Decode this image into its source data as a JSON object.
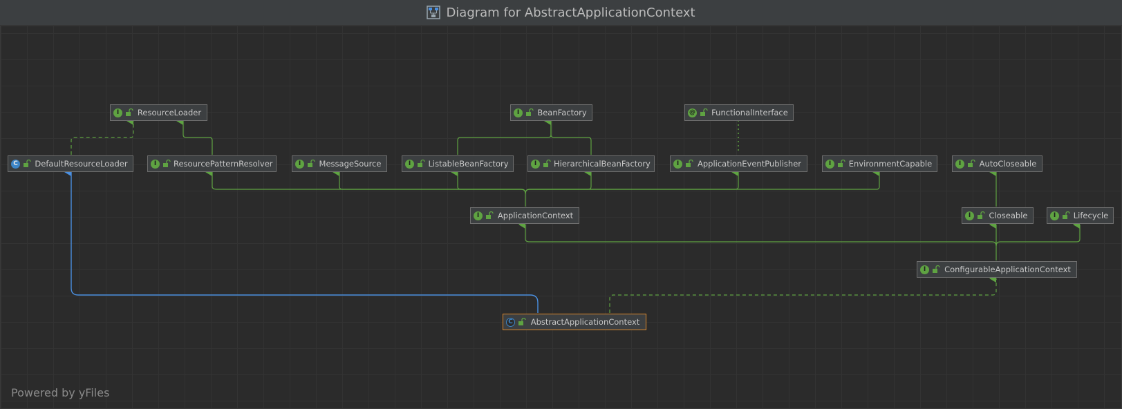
{
  "window": {
    "title": "Diagram for AbstractApplicationContext"
  },
  "footer": {
    "text": "Powered by yFiles"
  },
  "colors": {
    "inheritance": "#5fa342",
    "class_extends": "#4a8fe0",
    "selected_border": "#e08a2c"
  },
  "nodes": {
    "resource_loader": {
      "label": "ResourceLoader",
      "kind": "interface",
      "kind_glyph": "I"
    },
    "bean_factory": {
      "label": "BeanFactory",
      "kind": "interface",
      "kind_glyph": "I"
    },
    "functional_interface": {
      "label": "FunctionalInterface",
      "kind": "annotation",
      "kind_glyph": "@"
    },
    "default_resource_loader": {
      "label": "DefaultResourceLoader",
      "kind": "class",
      "kind_glyph": "C"
    },
    "resource_pattern_resolver": {
      "label": "ResourcePatternResolver",
      "kind": "interface",
      "kind_glyph": "I"
    },
    "message_source": {
      "label": "MessageSource",
      "kind": "interface",
      "kind_glyph": "I"
    },
    "listable_bean_factory": {
      "label": "ListableBeanFactory",
      "kind": "interface",
      "kind_glyph": "I"
    },
    "hierarchical_bean_factory": {
      "label": "HierarchicalBeanFactory",
      "kind": "interface",
      "kind_glyph": "I"
    },
    "application_event_publisher": {
      "label": "ApplicationEventPublisher",
      "kind": "interface",
      "kind_glyph": "I"
    },
    "environment_capable": {
      "label": "EnvironmentCapable",
      "kind": "interface",
      "kind_glyph": "I"
    },
    "auto_closeable": {
      "label": "AutoCloseable",
      "kind": "interface",
      "kind_glyph": "I"
    },
    "application_context": {
      "label": "ApplicationContext",
      "kind": "interface",
      "kind_glyph": "I"
    },
    "closeable": {
      "label": "Closeable",
      "kind": "interface",
      "kind_glyph": "I"
    },
    "lifecycle": {
      "label": "Lifecycle",
      "kind": "interface",
      "kind_glyph": "I"
    },
    "configurable_application_context": {
      "label": "ConfigurableApplicationContext",
      "kind": "interface",
      "kind_glyph": "I"
    },
    "abstract_application_context": {
      "label": "AbstractApplicationContext",
      "kind": "abstract",
      "kind_glyph": "C",
      "selected": true
    }
  },
  "edges": [
    {
      "from": "default_resource_loader",
      "to": "resource_loader",
      "type": "implements"
    },
    {
      "from": "resource_pattern_resolver",
      "to": "resource_loader",
      "type": "extends"
    },
    {
      "from": "listable_bean_factory",
      "to": "bean_factory",
      "type": "extends"
    },
    {
      "from": "hierarchical_bean_factory",
      "to": "bean_factory",
      "type": "extends"
    },
    {
      "from": "application_event_publisher",
      "to": "functional_interface",
      "type": "annotated"
    },
    {
      "from": "application_context",
      "to": "resource_pattern_resolver",
      "type": "extends"
    },
    {
      "from": "application_context",
      "to": "message_source",
      "type": "extends"
    },
    {
      "from": "application_context",
      "to": "listable_bean_factory",
      "type": "extends"
    },
    {
      "from": "application_context",
      "to": "hierarchical_bean_factory",
      "type": "extends"
    },
    {
      "from": "application_context",
      "to": "application_event_publisher",
      "type": "extends"
    },
    {
      "from": "application_context",
      "to": "environment_capable",
      "type": "extends"
    },
    {
      "from": "closeable",
      "to": "auto_closeable",
      "type": "extends"
    },
    {
      "from": "configurable_application_context",
      "to": "application_context",
      "type": "extends"
    },
    {
      "from": "configurable_application_context",
      "to": "closeable",
      "type": "extends"
    },
    {
      "from": "configurable_application_context",
      "to": "lifecycle",
      "type": "extends"
    },
    {
      "from": "abstract_application_context",
      "to": "configurable_application_context",
      "type": "implements"
    },
    {
      "from": "abstract_application_context",
      "to": "default_resource_loader",
      "type": "class_extends"
    }
  ]
}
